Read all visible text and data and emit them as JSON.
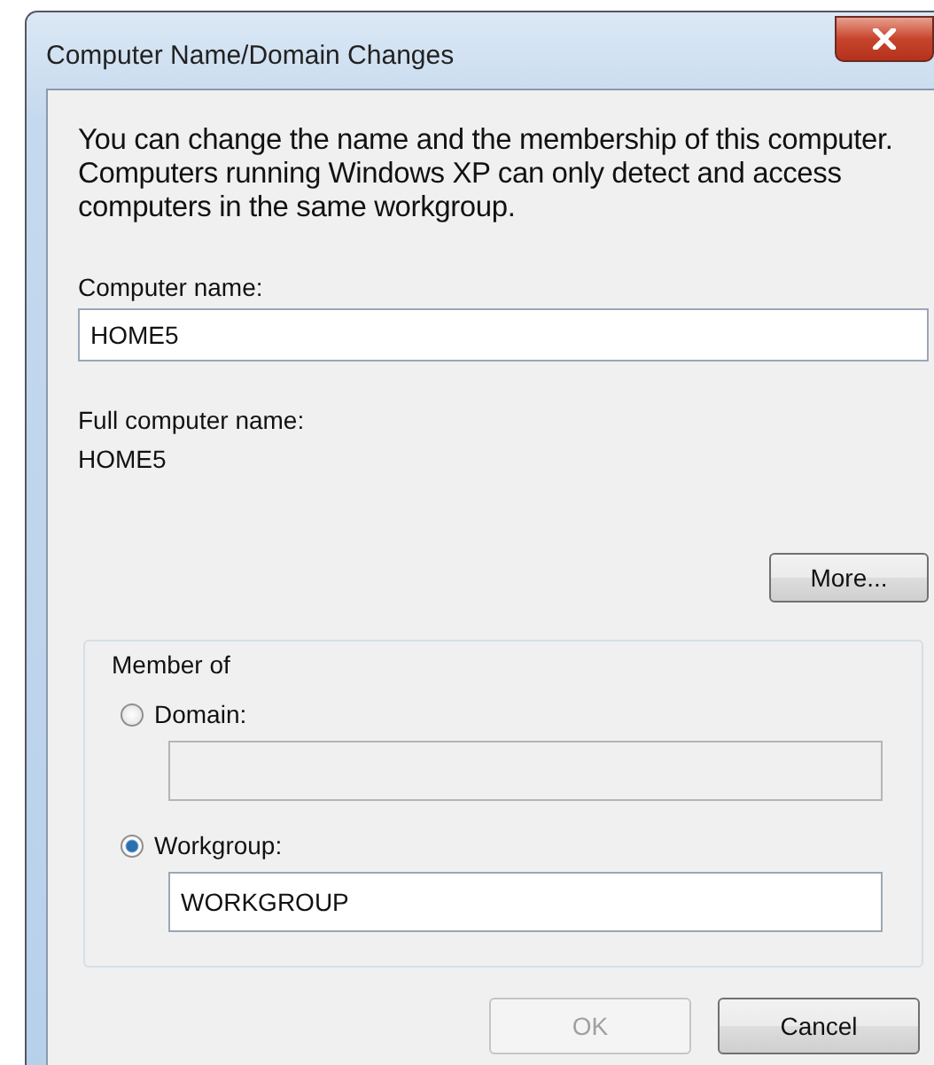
{
  "window": {
    "title": "Computer Name/Domain Changes"
  },
  "description": "You can change the name and the membership of this computer. Computers running Windows XP can only detect and access computers in the same workgroup.",
  "computer_name": {
    "label": "Computer name:",
    "value": "HOME5"
  },
  "full_computer_name": {
    "label": "Full computer name:",
    "value": "HOME5"
  },
  "more_button": {
    "label": "More..."
  },
  "member_of": {
    "title": "Member of",
    "options": [
      {
        "label": "Domain:",
        "selected": false,
        "disabled": true
      },
      {
        "label": "Workgroup:",
        "selected": true,
        "value": "WORKGROUP",
        "disabled": false
      }
    ]
  },
  "buttons": [
    {
      "label": "OK",
      "disabled": true
    },
    {
      "label": "Cancel",
      "disabled": false
    }
  ]
}
